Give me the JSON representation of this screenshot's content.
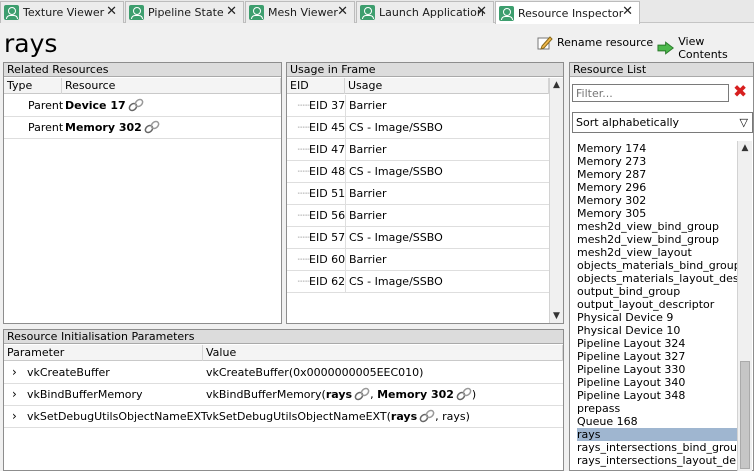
{
  "tabs": [
    {
      "label": "Texture Viewer"
    },
    {
      "label": "Pipeline State"
    },
    {
      "label": "Mesh Viewer"
    },
    {
      "label": "Launch Application"
    },
    {
      "label": "Resource Inspector"
    }
  ],
  "header": {
    "title": "rays",
    "rename_label": "Rename resource",
    "view_label": "View Contents"
  },
  "related": {
    "title": "Related Resources",
    "col_type": "Type",
    "col_resource": "Resource",
    "rows": [
      {
        "type": "Parent",
        "resource": "Device 17"
      },
      {
        "type": "Parent",
        "resource": "Memory 302"
      }
    ]
  },
  "usage": {
    "title": "Usage in Frame",
    "col_eid": "EID",
    "col_usage": "Usage",
    "rows": [
      {
        "eid": "EID 37",
        "usage": "Barrier"
      },
      {
        "eid": "EID 45",
        "usage": "CS - Image/SSBO"
      },
      {
        "eid": "EID 47",
        "usage": "Barrier"
      },
      {
        "eid": "EID 48",
        "usage": "CS - Image/SSBO"
      },
      {
        "eid": "EID 51",
        "usage": "Barrier"
      },
      {
        "eid": "EID 56",
        "usage": "Barrier"
      },
      {
        "eid": "EID 57",
        "usage": "CS - Image/SSBO"
      },
      {
        "eid": "EID 60",
        "usage": "Barrier"
      },
      {
        "eid": "EID 62",
        "usage": "CS - Image/SSBO"
      }
    ]
  },
  "init": {
    "title": "Resource Initialisation Parameters",
    "col_param": "Parameter",
    "col_value": "Value",
    "rows": [
      {
        "param": "vkCreateBuffer",
        "value": "vkCreateBuffer(0x0000000005EEC010)"
      },
      {
        "param": "vkBindBufferMemory",
        "value_prefix": "vkBindBufferMemory(",
        "arg1": "rays",
        "sep": ",",
        "arg2": "Memory 302",
        "value_suffix": ")"
      },
      {
        "param": "vkSetDebugUtilsObjectNameEXT",
        "value_prefix": "vkSetDebugUtilsObjectNameEXT(",
        "arg1": "rays",
        "value_suffix": ", rays)"
      }
    ]
  },
  "resource_list": {
    "title": "Resource List",
    "filter_placeholder": "Filter...",
    "sort_value": "Sort alphabetically",
    "selected": "rays",
    "items": [
      "Memory 174",
      "Memory 273",
      "Memory 287",
      "Memory 296",
      "Memory 302",
      "Memory 305",
      "mesh2d_view_bind_group",
      "mesh2d_view_bind_group",
      "mesh2d_view_layout",
      "objects_materials_bind_group",
      "objects_materials_layout_des...",
      "output_bind_group",
      "output_layout_descriptor",
      "Physical Device 9",
      "Physical Device 10",
      "Pipeline Layout 324",
      "Pipeline Layout 327",
      "Pipeline Layout 330",
      "Pipeline Layout 340",
      "Pipeline Layout 348",
      "prepass",
      "Queue 168",
      "rays",
      "rays_intersections_bind_group",
      "rays_intersections_layout_de..."
    ]
  },
  "colors": {
    "accent_tab_icon": "#3d9e6e",
    "selection": "#9fb6d0",
    "clear_x": "#d71f1f"
  }
}
